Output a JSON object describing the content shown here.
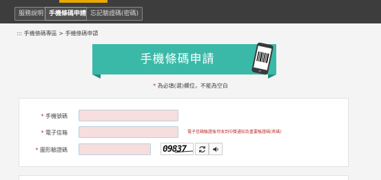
{
  "nav": {
    "tabs": [
      {
        "label": "服務說明"
      },
      {
        "label": "手機條碼申請"
      },
      {
        "label": "忘記驗證碼(密碼)"
      }
    ],
    "active_index": 1
  },
  "breadcrumb": {
    "prefix": ":::",
    "items": [
      "手機條碼專區",
      "手機條碼申請"
    ],
    "separator": ">"
  },
  "banner": {
    "title": "手機條碼申請",
    "icon": "phone-barcode-icon"
  },
  "required_note": {
    "star": "*",
    "text": "為必填(選)欄位，不能為空白"
  },
  "form": {
    "phone": {
      "star": "*",
      "label": "手機號碼",
      "value": ""
    },
    "email": {
      "star": "*",
      "label": "電子信箱",
      "value": "",
      "hint": "電子信箱驗證後可收到中獎通知及重要驗證碼(密碼)"
    },
    "captcha": {
      "star": "*",
      "label": "圖形驗證碼",
      "value": "",
      "image_text": "09837"
    }
  },
  "colors": {
    "nav_bg": "#3d3d3d",
    "nav_accent": "#e8a800",
    "banner": "#3bb9a8",
    "required": "#d02020"
  }
}
